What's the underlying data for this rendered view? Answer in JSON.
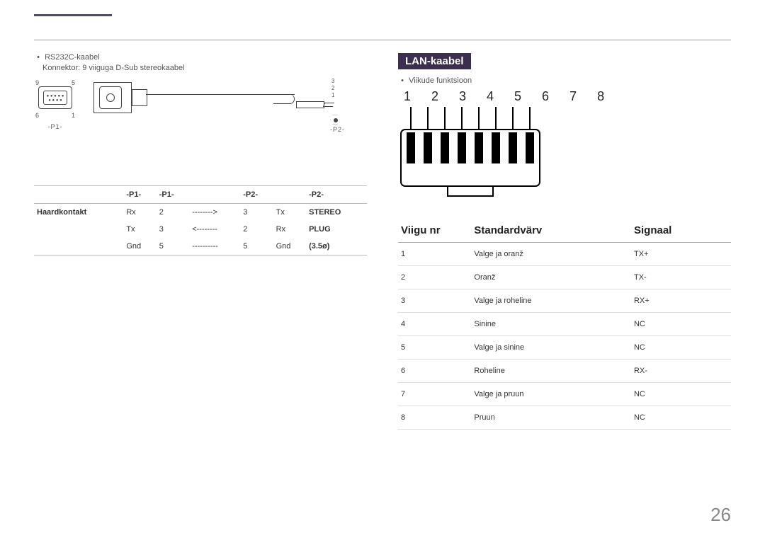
{
  "left": {
    "bullet": "RS232C-kaabel",
    "subline": "Konnektor: 9 viiguga D-Sub stereokaabel",
    "diagram": {
      "p1": "-P1-",
      "p2": "-P2-",
      "num9": "9",
      "num5": "5",
      "num6": "6",
      "num1": "1",
      "jack3": "3",
      "jack2": "2",
      "jack1": "1"
    },
    "table": {
      "hdr": {
        "c1": "-P1-",
        "c2": "-P1-",
        "c3": "-P2-",
        "c4": "-P2-"
      },
      "left_label": "Haardkontakt",
      "right_top": "STEREO",
      "right_mid": "PLUG",
      "right_bot": "(3.5ø)",
      "rows": [
        {
          "a": "Rx",
          "b": "2",
          "arrow": "-------->",
          "c": "3",
          "d": "Tx"
        },
        {
          "a": "Tx",
          "b": "3",
          "arrow": "<--------",
          "c": "2",
          "d": "Rx"
        },
        {
          "a": "Gnd",
          "b": "5",
          "arrow": "----------",
          "c": "5",
          "d": "Gnd"
        }
      ]
    }
  },
  "right": {
    "title": "LAN-kaabel",
    "bullet": "Viikude funktsioon",
    "pin_numbers": "1 2 3 4 5 6 7 8",
    "table": {
      "headers": {
        "pin": "Viigu nr",
        "color": "Standardvärv",
        "signal": "Signaal"
      },
      "rows": [
        {
          "pin": "1",
          "color": "Valge ja oranž",
          "signal": "TX+"
        },
        {
          "pin": "2",
          "color": "Oranž",
          "signal": "TX-"
        },
        {
          "pin": "3",
          "color": "Valge ja roheline",
          "signal": "RX+"
        },
        {
          "pin": "4",
          "color": "Sinine",
          "signal": "NC"
        },
        {
          "pin": "5",
          "color": "Valge ja sinine",
          "signal": "NC"
        },
        {
          "pin": "6",
          "color": "Roheline",
          "signal": "RX-"
        },
        {
          "pin": "7",
          "color": "Valge ja pruun",
          "signal": "NC"
        },
        {
          "pin": "8",
          "color": "Pruun",
          "signal": "NC"
        }
      ]
    }
  },
  "page_number": "26"
}
